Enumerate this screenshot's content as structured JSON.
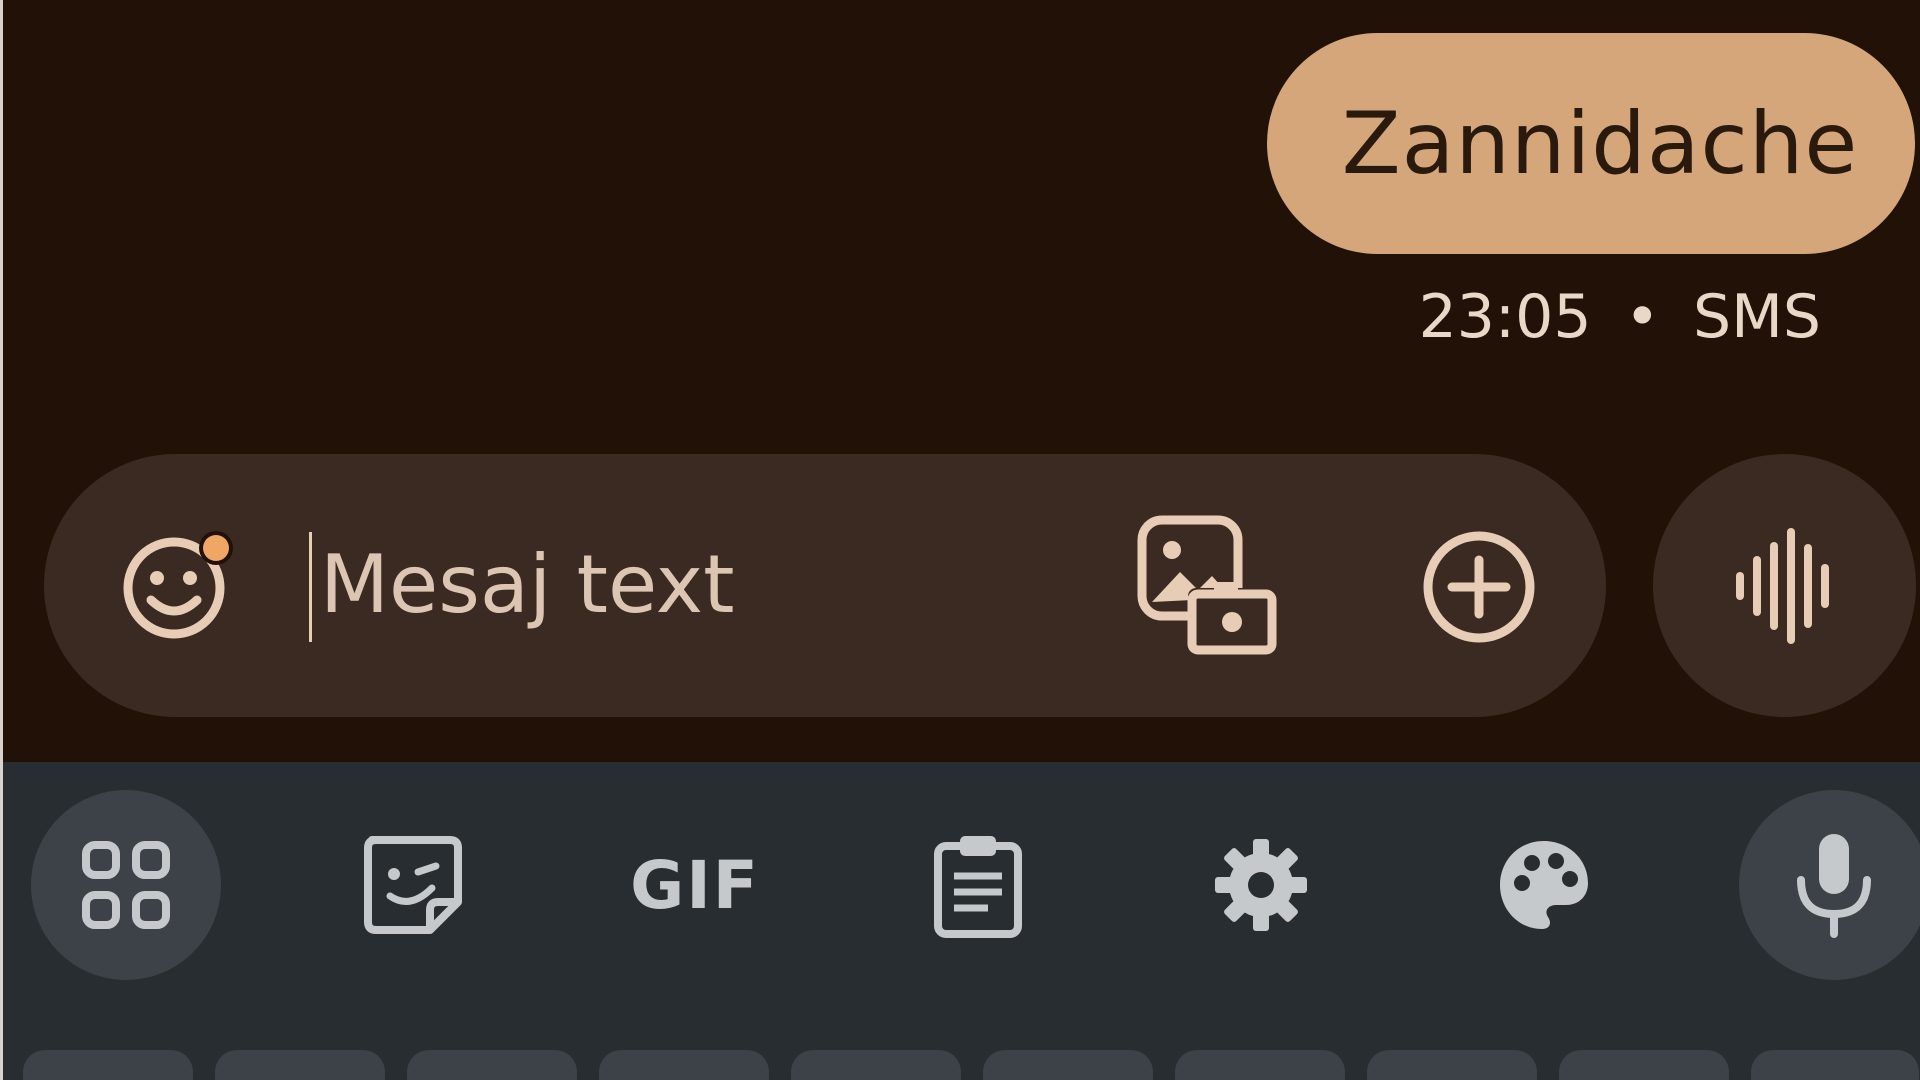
{
  "conversation": {
    "sent_message": {
      "text": "Zannidache",
      "time": "23:05",
      "separator": "•",
      "channel": "SMS"
    }
  },
  "compose": {
    "placeholder": "Mesaj text",
    "value": "",
    "icons": {
      "emoji": "emoji-smiley-icon",
      "gallery": "gallery-camera-icon",
      "add": "add-circle-icon",
      "voice": "voice-waveform-icon"
    }
  },
  "keyboard_toolbar": {
    "items": [
      {
        "name": "apps-grid",
        "icon": "grid-icon"
      },
      {
        "name": "sticker",
        "icon": "sticker-icon"
      },
      {
        "name": "gif",
        "label": "GIF"
      },
      {
        "name": "clipboard",
        "icon": "clipboard-icon"
      },
      {
        "name": "settings",
        "icon": "gear-icon"
      },
      {
        "name": "theme",
        "icon": "palette-icon"
      },
      {
        "name": "voice-input",
        "icon": "microphone-icon"
      }
    ]
  },
  "colors": {
    "chat_background": "#211106",
    "bubble": "#d4a67a",
    "compose_background": "#3b2a21",
    "compose_icon": "#e8cdb6",
    "emoji_dot": "#f0a664",
    "keyboard_background": "#282d32",
    "keyboard_icon": "#c5c9cc",
    "keyboard_circle": "#3c4247"
  }
}
